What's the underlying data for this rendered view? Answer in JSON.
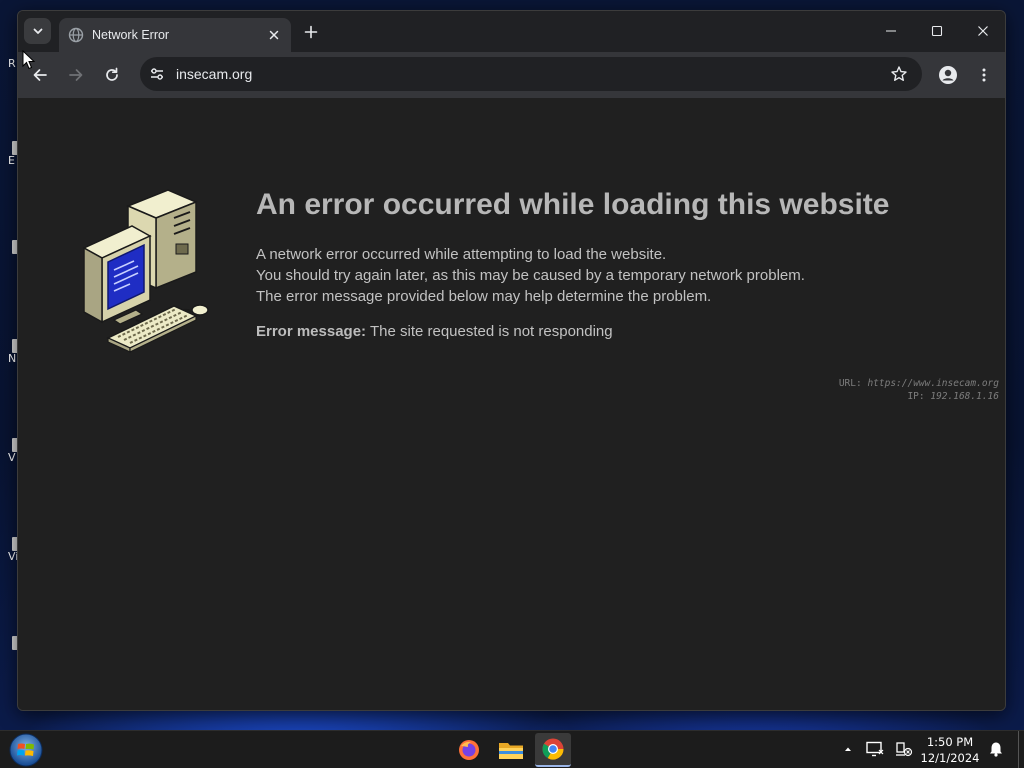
{
  "browser": {
    "tab_title": "Network Error",
    "url": "insecam.org"
  },
  "error_page": {
    "heading": "An error occurred while loading this website",
    "lines": [
      "A network error occurred while attempting to load the website.",
      "You should try again later, as this may be caused by a temporary network problem.",
      "The error message provided below may help determine the problem."
    ],
    "error_label": "Error message:",
    "error_text": "The site requested is not responding",
    "diag_url_label": "URL:",
    "diag_url": "https://www.insecam.org",
    "diag_ip_label": "IP:",
    "diag_ip": "192.168.1.16"
  },
  "desktop": {
    "icon_labels": [
      "R",
      "E",
      "",
      "N",
      "V",
      "Vis",
      ""
    ]
  },
  "taskbar": {
    "apps": [
      "firefox-icon",
      "file-explorer-icon",
      "chrome-icon"
    ],
    "active_app": "chrome-icon",
    "time": "1:50 PM",
    "date": "12/1/2024"
  },
  "colors": {
    "page_bg": "#202020",
    "heading": "#b7b7b7",
    "body_text": "#c2c2c2",
    "toolbar": "#35363a",
    "tabstrip": "#202124"
  }
}
